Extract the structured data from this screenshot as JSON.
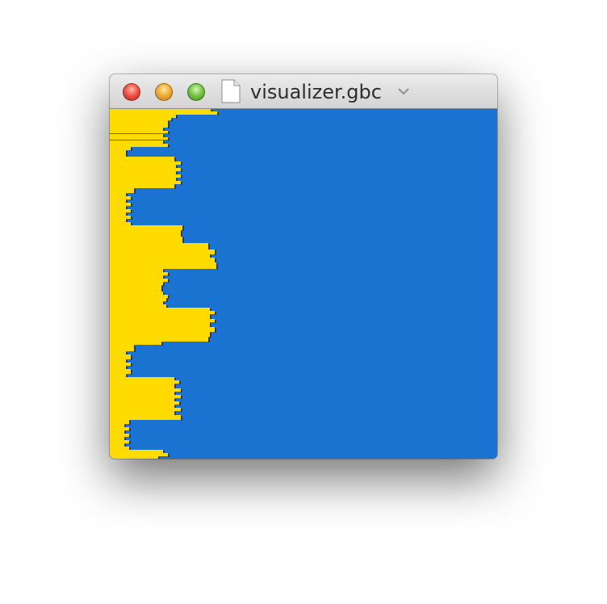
{
  "window": {
    "title": "visualizer.gbc"
  },
  "icons": {
    "close": "close-traffic-light-icon",
    "minimize": "minimize-traffic-light-icon",
    "zoom": "zoom-traffic-light-icon",
    "document": "document-icon",
    "title_menu": "chevron-down-icon"
  },
  "colors": {
    "background": "#1a73d0",
    "bars": "#ffdb00",
    "bar_shadow": "#3a3a3a"
  }
}
